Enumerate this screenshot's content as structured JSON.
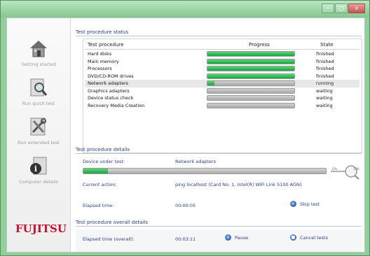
{
  "window": {
    "title": "",
    "controls": {
      "minimize": "–",
      "maximize": "□",
      "close": "x"
    }
  },
  "sidebar": {
    "items": [
      {
        "label": "Getting started",
        "icon": "house-icon"
      },
      {
        "label": "Run quick test",
        "icon": "magnifier-icon"
      },
      {
        "label": "Run extended test",
        "icon": "tools-icon"
      },
      {
        "label": "Computer details",
        "icon": "info-icon"
      }
    ],
    "logo": "FUJITSU"
  },
  "status": {
    "section_title": "Test procedure status",
    "columns": [
      "Test procedure",
      "Progress",
      "State"
    ],
    "rows": [
      {
        "name": "Hard disks",
        "progress": 1.0,
        "state": "finished"
      },
      {
        "name": "Main memory",
        "progress": 1.0,
        "state": "finished"
      },
      {
        "name": "Processors",
        "progress": 1.0,
        "state": "finished"
      },
      {
        "name": "DVD/CD-ROM drives",
        "progress": 1.0,
        "state": "finished"
      },
      {
        "name": "Network adapters",
        "progress": 0.08,
        "state": "running"
      },
      {
        "name": "Graphics adapters",
        "progress": 0.0,
        "state": "waiting"
      },
      {
        "name": "Device status check",
        "progress": 0.0,
        "state": "waiting"
      },
      {
        "name": "Recovery Media Creation",
        "progress": 0.0,
        "state": "waiting"
      }
    ]
  },
  "details": {
    "section_title": "Test procedure details",
    "device_label": "Device under test:",
    "device_value": "Network adapters",
    "progress": 0.1,
    "speed_labels": {
      "min": "0%",
      "max": "100"
    },
    "action_label": "Current action:",
    "action_value": "ping localhost (Card No. 1, Intel(R) WiFi Link 5100 AGN)",
    "elapsed_label": "Elapsed time:",
    "elapsed_value": "00:00:05",
    "skip_label": "Skip test"
  },
  "overall": {
    "section_title": "Test procedure overall details",
    "elapsed_label": "Elapsed time (overall):",
    "elapsed_value": "00:03:11",
    "pause_label": "Pause",
    "cancel_label": "Cancel tests"
  }
}
